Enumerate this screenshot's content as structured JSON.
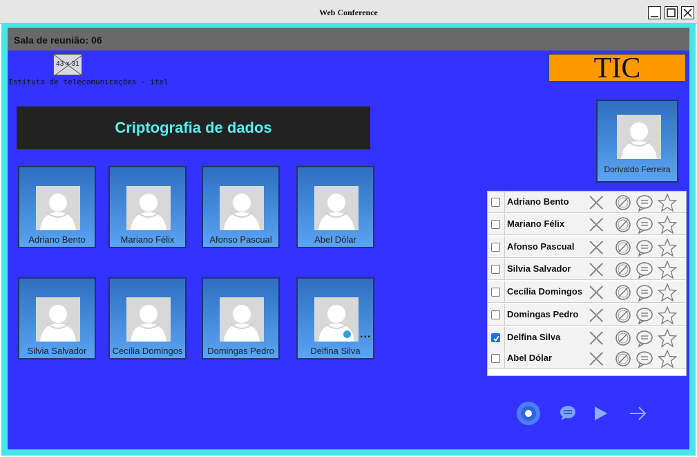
{
  "window": {
    "title": "Web Conference"
  },
  "header": {
    "room_label": "Sala de reunião: 06"
  },
  "logo": {
    "placeholder_text": "43 × 31",
    "institution": "Istituto de telecomunicações - itel"
  },
  "brand": {
    "text": "TIC"
  },
  "banner": {
    "title": "Criptografia de dados"
  },
  "host": {
    "name": "Dorivaldo Ferreira"
  },
  "participants": [
    {
      "name": "Adriano Bento"
    },
    {
      "name": "Mariano Félix"
    },
    {
      "name": "Afonso Pascual"
    },
    {
      "name": "Abel Dólar"
    },
    {
      "name": "Silvia Salvador"
    },
    {
      "name": "Cecília Domingos"
    },
    {
      "name": "Domingas Pedro"
    },
    {
      "name": "Delfina Silva",
      "more": "..."
    }
  ],
  "list": [
    {
      "name": "Adriano Bento",
      "checked": false
    },
    {
      "name": "Mariano Félix",
      "checked": false
    },
    {
      "name": "Afonso Pascual",
      "checked": false
    },
    {
      "name": "Silvia Salvador",
      "checked": false
    },
    {
      "name": "Cecília Domingos",
      "checked": false
    },
    {
      "name": "Domingas Pedro",
      "checked": false
    },
    {
      "name": "Delfina Silva",
      "checked": true
    },
    {
      "name": "Abel Dólar",
      "checked": false
    }
  ],
  "row_icons": [
    "close-icon",
    "block-icon",
    "chat-bubble-icon",
    "star-icon"
  ],
  "controls": [
    "record-icon",
    "chat-icon",
    "play-icon",
    "arrow-right-icon"
  ],
  "colors": {
    "background": "#3333ff",
    "frame": "#47e6e6",
    "header": "#696969",
    "brand": "#ff9900",
    "banner_text": "#5cefef"
  }
}
